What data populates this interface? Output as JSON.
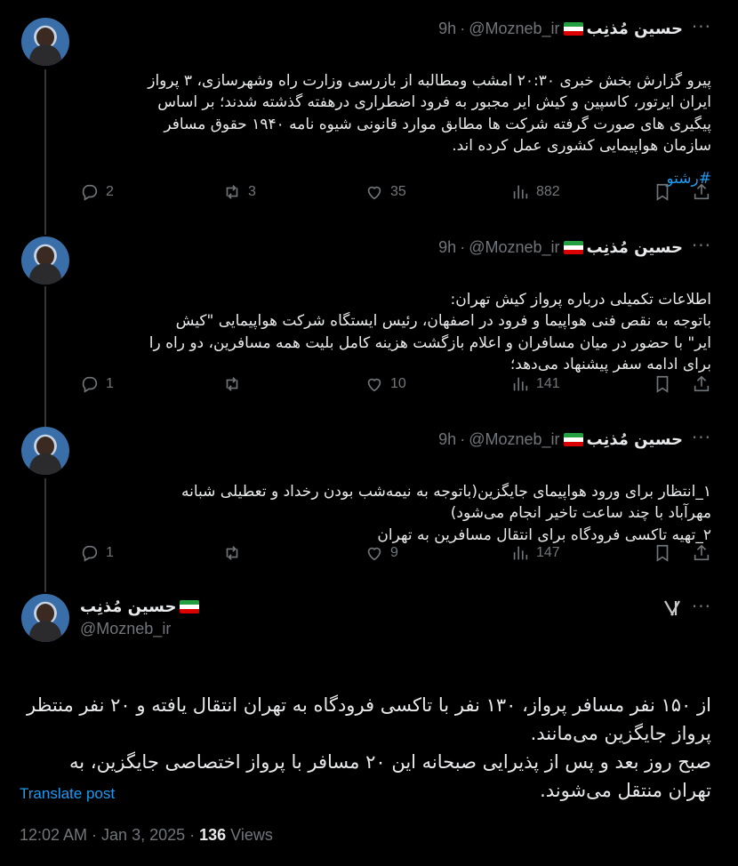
{
  "author": {
    "name": "حسین مُذنِب",
    "handle": "@Mozneb_ir",
    "separator": "·"
  },
  "tweets": [
    {
      "time": "9h",
      "text": "پیرو گزارش بخش خبری ۲۰:۳۰ امشب ومطالبه از بازرسی وزارت راه وشهرسازی، ۳ پرواز\nایران ایرتور، کاسپین و کیش ایر مجبور به فرود اضطراری درهفته گذشته شدند؛ بر اساس\nپیگیری های صورت گرفته شرکت ها مطابق موارد قانونی شیوه نامه ۱۹۴۰ حقوق مسافر\nسازمان هواپیمایی کشوری عمل کرده اند.",
      "hashtag": "#رشتو",
      "replies": "2",
      "reposts": "3",
      "likes": "35",
      "views": "882"
    },
    {
      "time": "9h",
      "text": "اطلاعات تکمیلی درباره پرواز کیش تهران:\nباتوجه به نقص فنی هواپیما و فرود در اصفهان، رئیس ایستگاه شرکت هواپیمایی \"کیش\nایر\" با حضور در میان مسافران و اعلام بازگشت هزینه کامل بلیت همه مسافرین، دو راه را\nبرای ادامه سفر پیشنهاد می‌دهد؛",
      "replies": "1",
      "reposts": "",
      "likes": "10",
      "views": "141"
    },
    {
      "time": "9h",
      "text": "۱_انتظار برای ورود هواپیمای جایگزین(باتوجه به نیمه‌شب بودن رخداد و تعطیلی شبانه\nمهرآباد با چند ساعت تاخیر انجام می‌شود)\n۲_تهیه تاکسی فرودگاه برای انتقال مسافرین به تهران",
      "replies": "1",
      "reposts": "",
      "likes": "9",
      "views": "147"
    }
  ],
  "main_tweet": {
    "text": "از ۱۵۰ نفر مسافر پرواز، ۱۳۰ نفر با تاکسی فرودگاه به تهران انتقال یافته و ۲۰ نفر منتظر\nپرواز جایگزین می‌مانند.\nصبح روز بعد و پس از پذیرایی صبحانه این ۲۰ مسافر با پرواز اختصاصی جایگزین، به\nتهران منتقل می‌شوند.",
    "translate_label": "Translate post",
    "timestamp": "12:02 AM · Jan 3, 2025 · ",
    "views_count": "136",
    "views_label": " Views"
  },
  "icons": {
    "more": "more-dots-icon",
    "grok": "grok-icon",
    "reply": "reply-icon",
    "repost": "repost-icon",
    "like": "like-icon",
    "views": "views-icon",
    "bookmark": "bookmark-icon",
    "share": "share-icon"
  },
  "colors": {
    "background": "#000000",
    "text": "#e7e9ea",
    "muted": "#71767b",
    "accent": "#1d9bf0"
  }
}
